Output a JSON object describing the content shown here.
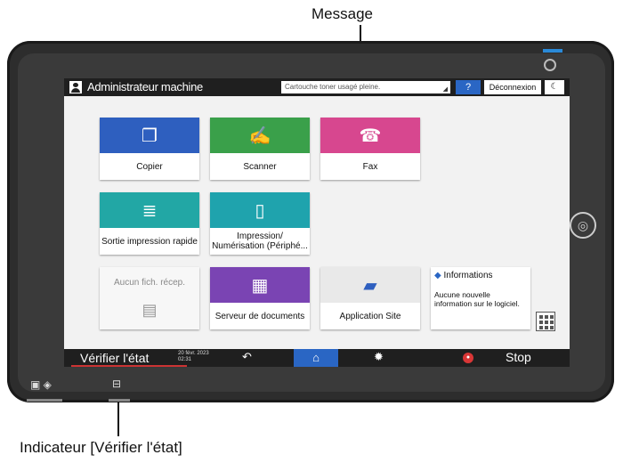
{
  "callouts": {
    "message": "Message",
    "check_status_indicator": "Indicateur [Vérifier l'état]"
  },
  "topbar": {
    "user": "Administrateur machine",
    "message_text": "Cartouche toner usagé pleine.",
    "help": "?",
    "logout": "Déconnexion",
    "moon": "☾"
  },
  "apps": {
    "copier": "Copier",
    "scanner": "Scanner",
    "fax": "Fax",
    "quick_print": "Sortie impression rapide",
    "print_scan": "Impression/ Numérisation (Périphé...",
    "no_fax": "Aucun fich. récep.",
    "doc_server": "Serveur de documents",
    "app_site": "Application Site",
    "info_title": "Informations",
    "info_text": "Aucune nouvelle information sur le logiciel."
  },
  "bottombar": {
    "check_status": "Vérifier l'état",
    "date": "20 févr. 2023",
    "time": "02:31",
    "stop": "Stop"
  },
  "colors": {
    "copier": "#2e5fbf",
    "scanner": "#3aa04a",
    "fax": "#d7478f",
    "quick_print": "#22a7a5",
    "print_scan": "#1fa3ad",
    "doc_server": "#7a44b3",
    "app_site": "#e9e9e9",
    "accent": "#2a66c4"
  },
  "icons": [
    "user-icon",
    "copy-icon",
    "scanner-icon",
    "fax-icon",
    "quick-print-icon",
    "usb-print-icon",
    "fax-tray-icon",
    "document-server-icon",
    "bag-icon",
    "info-icon",
    "grid-icon",
    "back-arrow-icon",
    "home-icon",
    "gear-icon",
    "stop-icon",
    "nfc-icon",
    "power-icon"
  ]
}
